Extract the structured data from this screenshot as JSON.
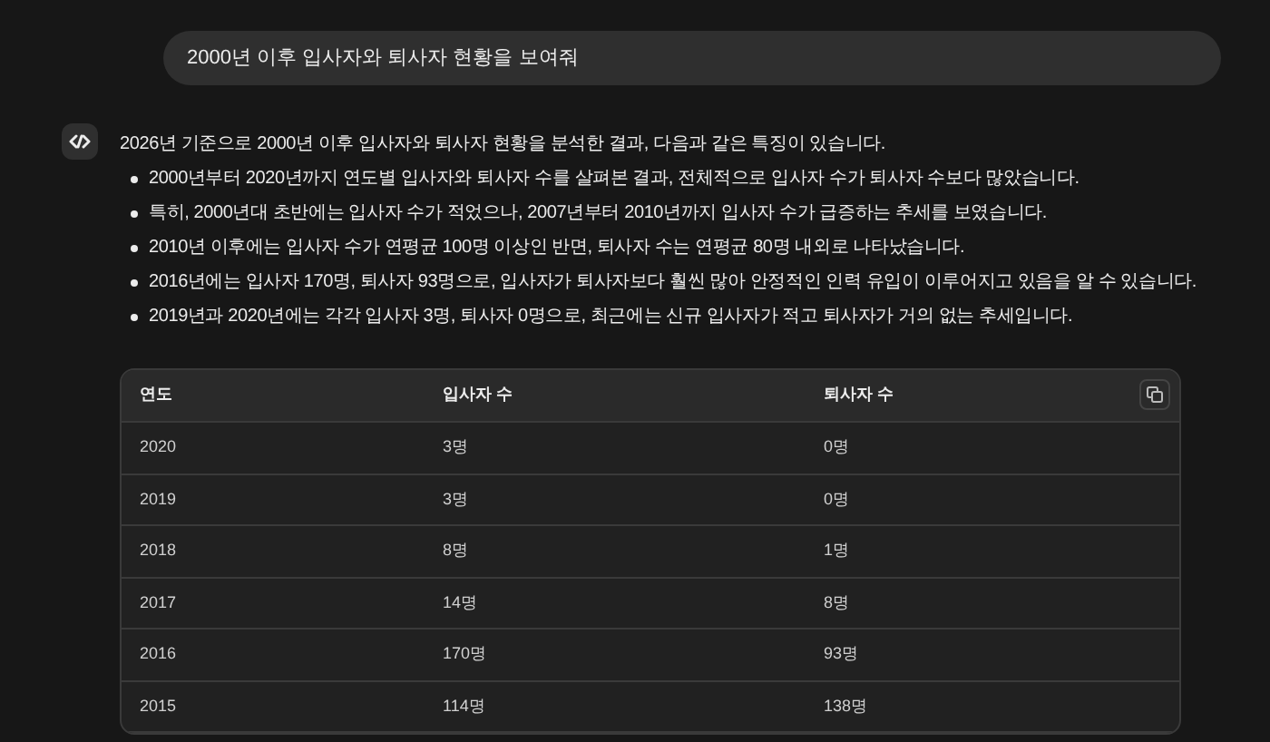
{
  "user_message": "2000년 이후 입사자와 퇴사자 현황을 보여줘",
  "assistant": {
    "intro": "2026년 기준으로 2000년 이후 입사자와 퇴사자 현황을 분석한 결과, 다음과 같은 특징이 있습니다.",
    "bullets": [
      "2000년부터 2020년까지 연도별 입사자와 퇴사자 수를 살펴본 결과, 전체적으로 입사자 수가 퇴사자 수보다 많았습니다.",
      "특히, 2000년대 초반에는 입사자 수가 적었으나, 2007년부터 2010년까지 입사자 수가 급증하는 추세를 보였습니다.",
      "2010년 이후에는 입사자 수가 연평균 100명 이상인 반면, 퇴사자 수는 연평균 80명 내외로 나타났습니다.",
      "2016년에는 입사자 170명, 퇴사자 93명으로, 입사자가 퇴사자보다 훨씬 많아 안정적인 인력 유입이 이루어지고 있음을 알 수 있습니다.",
      "2019년과 2020년에는 각각 입사자 3명, 퇴사자 0명으로, 최근에는 신규 입사자가 적고 퇴사자가 거의 없는 추세입니다."
    ]
  },
  "table": {
    "columns": [
      "연도",
      "입사자 수",
      "퇴사자 수"
    ],
    "rows": [
      [
        "2020",
        "3명",
        "0명"
      ],
      [
        "2019",
        "3명",
        "0명"
      ],
      [
        "2018",
        "8명",
        "1명"
      ],
      [
        "2017",
        "14명",
        "8명"
      ],
      [
        "2016",
        "170명",
        "93명"
      ],
      [
        "2015",
        "114명",
        "138명"
      ]
    ]
  }
}
